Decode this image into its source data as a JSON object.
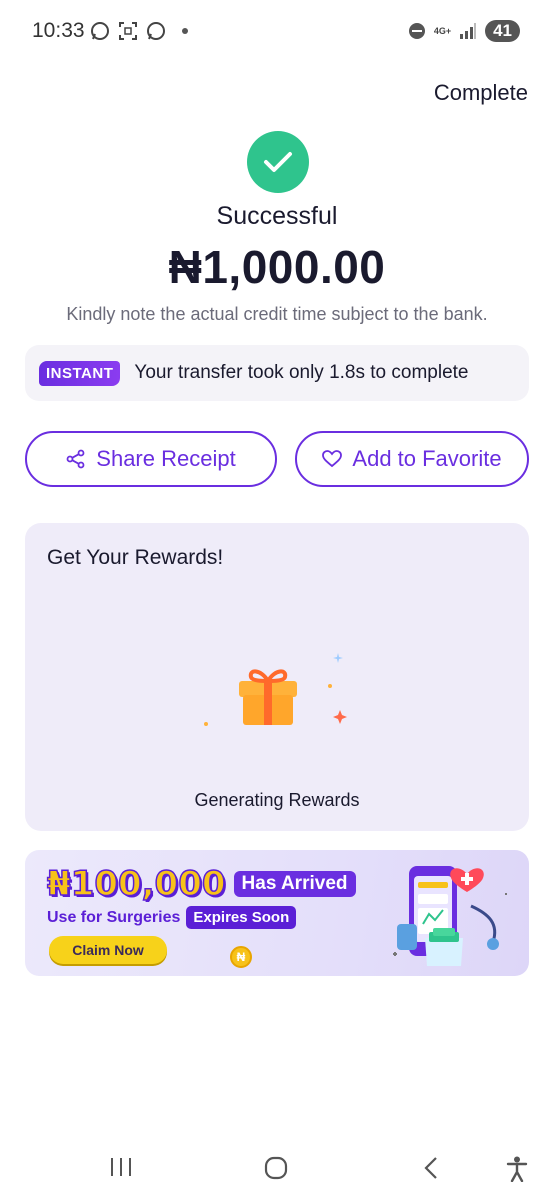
{
  "status_bar": {
    "time": "10:33",
    "network": "4G+",
    "battery": "41"
  },
  "header": {
    "complete_label": "Complete"
  },
  "result": {
    "title": "Successful",
    "amount": "₦1,000.00",
    "note": "Kindly note the actual credit time subject to the bank."
  },
  "instant": {
    "badge": "INSTANT",
    "text": "Your transfer took only 1.8s to complete"
  },
  "actions": {
    "share_label": "Share Receipt",
    "favorite_label": "Add to Favorite"
  },
  "rewards": {
    "title": "Get Your Rewards!",
    "status": "Generating Rewards"
  },
  "promo": {
    "amount": "₦100,000",
    "arrived": "Has Arrived",
    "subtitle": "Use for Surgeries",
    "expires": "Expires Soon",
    "claim_label": "Claim Now"
  },
  "colors": {
    "accent": "#6a2ee0",
    "success": "#2fc48d",
    "promo_yellow": "#f7c21a"
  }
}
